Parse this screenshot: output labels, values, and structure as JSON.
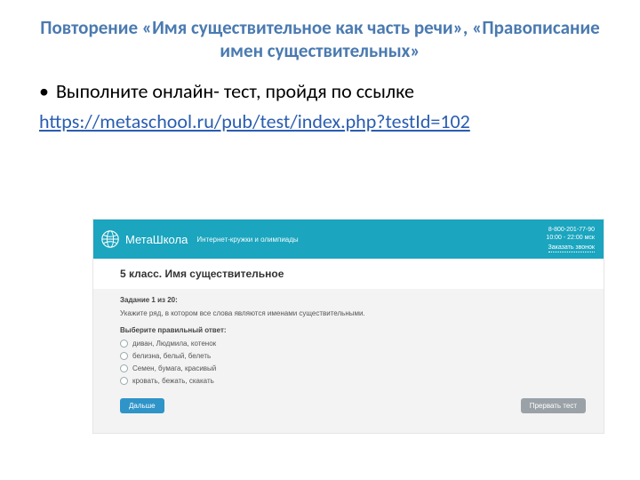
{
  "slide": {
    "title": "Повторение «Имя существительное как часть речи», «Правописание имен существительных»",
    "bullet": "Выполните онлайн- тест, пройдя по ссылке",
    "link": "https://metaschool.ru/pub/test/index.php?testId=102"
  },
  "colors": {
    "title": "#4a7ab0",
    "link": "#2a5db0",
    "header_bg": "#1ba5bf",
    "primary_btn": "#2f94c8",
    "secondary_btn": "#9aa2a7"
  },
  "site": {
    "brand_name": "МетаШкола",
    "brand_tagline": "Интернет-кружки и олимпиады",
    "contact": {
      "phone": "8-800-201-77-90",
      "hours": "10:00 - 22:00 мск",
      "callback": "Заказать звонок"
    },
    "page_title": "5 класс. Имя существительное",
    "quiz": {
      "task_number": "Задание 1 из 20:",
      "task_text": "Укажите ряд, в котором все слова являются именами существительными.",
      "pick_label": "Выберите правильный ответ:",
      "options": [
        "диван, Людмила, котенок",
        "белизна, белый, белеть",
        "Семен, бумага, красивый",
        "кровать, бежать, скакать"
      ],
      "next_btn": "Дальше",
      "abort_btn": "Прервать тест"
    }
  }
}
